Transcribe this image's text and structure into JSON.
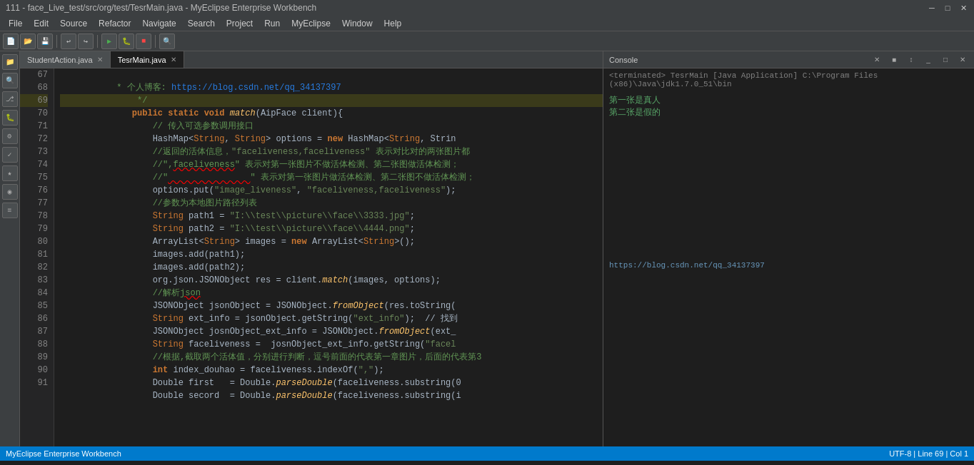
{
  "titleBar": {
    "title": "111 - face_Live_test/src/org/test/TesrMain.java - MyEclipse Enterprise Workbench",
    "minimize": "─",
    "maximize": "□",
    "close": "✕"
  },
  "menuBar": {
    "items": [
      "File",
      "Edit",
      "Source",
      "Refactor",
      "Navigate",
      "Search",
      "Project",
      "Run",
      "MyEclipse",
      "Window",
      "Help"
    ]
  },
  "tabs": [
    {
      "label": "StudentAction.java",
      "active": false
    },
    {
      "label": "TesrMain.java",
      "active": true
    }
  ],
  "console": {
    "title": "Console",
    "terminated": "<terminated> TesrMain [Java Application] C:\\Program Files (x86)\\Java\\jdk1.7.0_51\\bin",
    "output1": "第一张是真人",
    "output2": "第二张是假的",
    "url": "https://blog.csdn.net/qq_34137397"
  },
  "lines": [
    {
      "num": "67",
      "content": "     * 个人博客: https://blog.csdn.net/qq_34137397",
      "type": "comment_url"
    },
    {
      "num": "68",
      "content": "     */",
      "type": "comment"
    },
    {
      "num": "69",
      "content": "    public static void match(AipFace client){",
      "type": "code"
    },
    {
      "num": "70",
      "content": "        // 传入可选参数调用接口",
      "type": "comment"
    },
    {
      "num": "71",
      "content": "        HashMap<String, String> options = new HashMap<String, Strin",
      "type": "code"
    },
    {
      "num": "72",
      "content": "        //返回的活体信息，\"faceliveness,faceliveness\" 表示对比对的两张图片都",
      "type": "comment_hl"
    },
    {
      "num": "73",
      "content": "        //\",faceliveness\" 表示对第一张图片不做活体检测、第二张图做活体检测；",
      "type": "comment"
    },
    {
      "num": "74",
      "content": "        //\"                \" 表示对第一张图片做活体检测、第二张图不做活体检测；",
      "type": "comment_red"
    },
    {
      "num": "75",
      "content": "        options.put(\"image_liveness\", \"faceliveness,faceliveness\");",
      "type": "code"
    },
    {
      "num": "76",
      "content": "        //参数为本地图片路径列表",
      "type": "comment"
    },
    {
      "num": "77",
      "content": "        String path1 = \"I:\\\\test\\\\picture\\\\face\\\\3333.jpg\";",
      "type": "code"
    },
    {
      "num": "78",
      "content": "        String path2 = \"I:\\\\test\\\\picture\\\\face\\\\4444.png\";",
      "type": "code"
    },
    {
      "num": "79",
      "content": "        ArrayList<String> images = new ArrayList<String>();",
      "type": "code"
    },
    {
      "num": "80",
      "content": "        images.add(path1);",
      "type": "code"
    },
    {
      "num": "81",
      "content": "        images.add(path2);",
      "type": "code"
    },
    {
      "num": "82",
      "content": "        org.json.JSONObject res = client.match(images, options);",
      "type": "code"
    },
    {
      "num": "83",
      "content": "        //解析json",
      "type": "comment_cn"
    },
    {
      "num": "84",
      "content": "        JSONObject jsonObject = JSONObject.fromObject(res.toString(",
      "type": "code"
    },
    {
      "num": "85",
      "content": "        String ext_info = jsonObject.getString(\"ext_info\");  // 找到",
      "type": "code"
    },
    {
      "num": "86",
      "content": "        JSONObject josnObject_ext_info = JSONObject.fromObject(ext_",
      "type": "code"
    },
    {
      "num": "87",
      "content": "        String faceliveness =  josnObject_ext_info.getString(\"facel",
      "type": "code"
    },
    {
      "num": "88",
      "content": "        //根据,截取两个活体值，分别进行判断，逗号前面的代表第一章图片，后面的代表第3",
      "type": "comment"
    },
    {
      "num": "89",
      "content": "        int index_douhao = faceliveness.indexOf(\",\");",
      "type": "code"
    },
    {
      "num": "90",
      "content": "        Double first   = Double.parseDouble(faceliveness.substring(0",
      "type": "code"
    },
    {
      "num": "91",
      "content": "        Double secord  = Double.parseDouble(faceliveness.substring(i",
      "type": "code"
    }
  ]
}
